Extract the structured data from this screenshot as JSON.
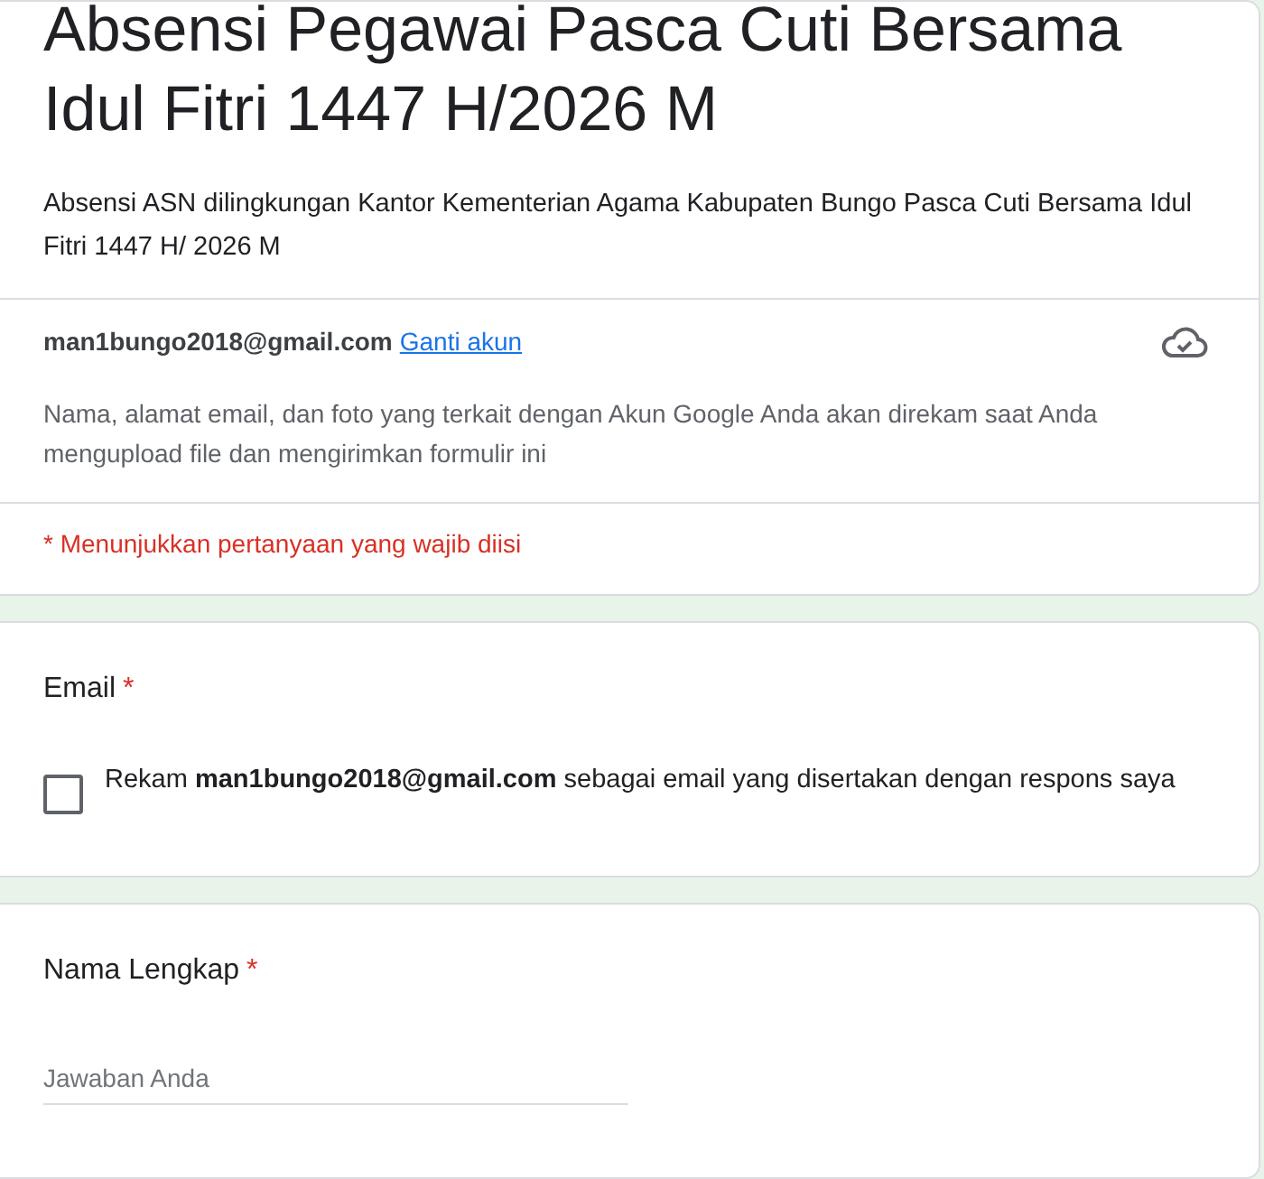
{
  "header": {
    "title": "Absensi Pegawai Pasca Cuti Bersama Idul Fitri 1447 H/2026 M",
    "description": "Absensi ASN dilingkungan Kantor Kementerian Agama Kabupaten Bungo Pasca Cuti Bersama Idul Fitri 1447 H/ 2026 M",
    "account_email": "man1bungo2018@gmail.com",
    "switch_account": "Ganti akun",
    "notice": "Nama, alamat email, dan foto yang terkait dengan Akun Google Anda akan direkam saat Anda mengupload file dan mengirimkan formulir ini",
    "required_note": "* Menunjukkan pertanyaan yang wajib diisi"
  },
  "questions": [
    {
      "kind": "checkbox",
      "title": "Email",
      "required_mark": "*",
      "option": "Rekam **man1bungo2018@gmail.com** sebagai email yang disertakan dengan respons saya",
      "checked": false
    },
    {
      "kind": "text",
      "title": "Nama Lengkap",
      "required_mark": "*",
      "placeholder": "Jawaban Anda"
    }
  ]
}
